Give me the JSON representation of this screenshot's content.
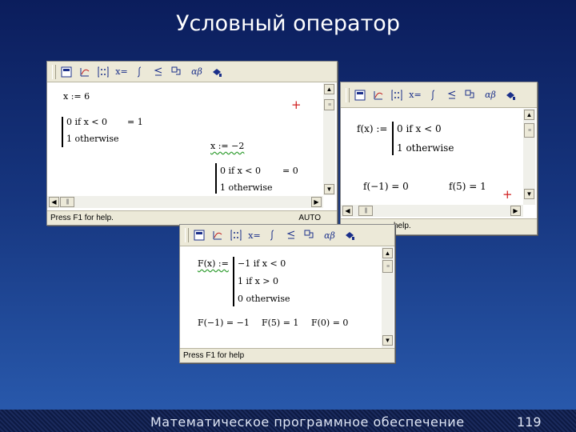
{
  "slide": {
    "title": "Условный оператор",
    "footer": "Математическое программное обеспечение",
    "page": "119"
  },
  "colors": {
    "accent": "#d02020",
    "toolbar_icon": "#1a2f8a"
  },
  "toolbar": {
    "icons": [
      "calculator-icon",
      "graph-icon",
      "matrix-icon",
      "evaluation-icon",
      "calculus-icon",
      "boolean-icon",
      "programming-icon",
      "greek-icon",
      "symbolic-icon"
    ],
    "eval_label": "x=",
    "greek_label": "αβ"
  },
  "window1": {
    "line1": "x := 6",
    "cond1": "0  if  x < 0",
    "res1": "= 1",
    "other1": "1  otherwise",
    "line2": "x := −2",
    "cond2": "0  if  x < 0",
    "res2": "= 0",
    "other2": "1  otherwise",
    "status": "Press F1 for help.",
    "mode": "AUTO"
  },
  "window2": {
    "def": "f(x) :=",
    "cond": "0  if  x < 0",
    "other": "1  otherwise",
    "eval1": "f(−1) = 0",
    "eval2": "f(5) = 1",
    "status_tail": "help."
  },
  "window3": {
    "def": "F(x) :=",
    "c1": "−1  if  x < 0",
    "c2": "1  if  x > 0",
    "c3": "0  otherwise",
    "e1": "F(−1) = −1",
    "e2": "F(5) = 1",
    "e3": "F(0) = 0",
    "status": "Press F1 for help"
  }
}
